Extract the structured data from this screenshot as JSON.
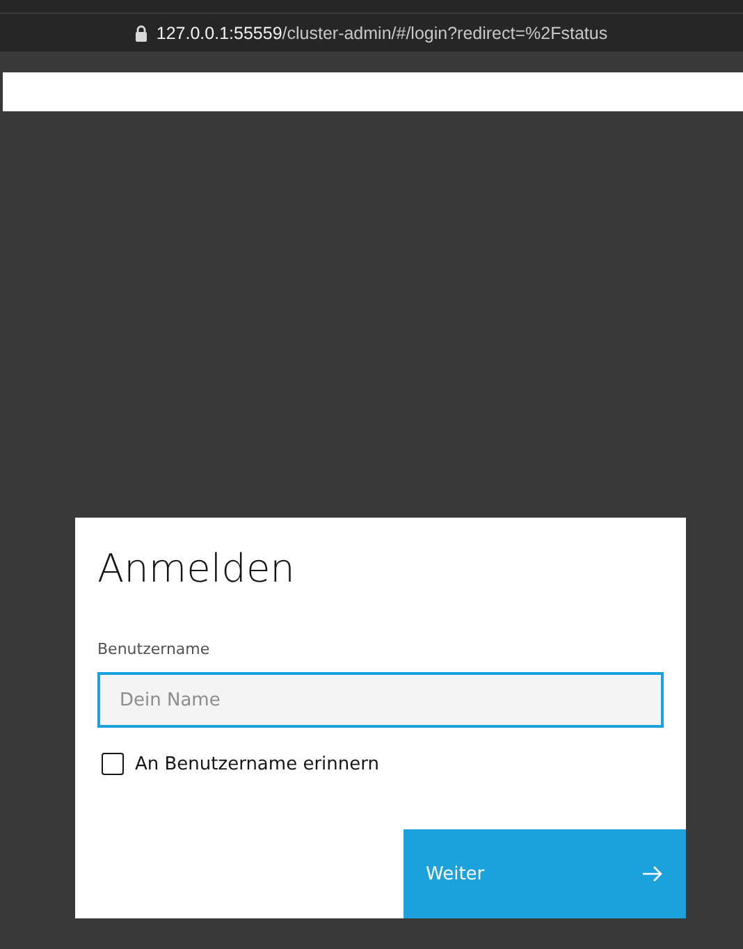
{
  "browser": {
    "url": "**127.0.0.1:55559**/cluster-admin/#/login?redirect=%2Fstatus",
    "secure": true
  },
  "login": {
    "title": "Anmelden",
    "field_label": "Benutzername",
    "placeholder": "Dein Name",
    "focused": true,
    "remember": {
      "label": "An Benutzername erinnern",
      "checked": false
    },
    "submit": {
      "label": "Weiter"
    }
  }
}
